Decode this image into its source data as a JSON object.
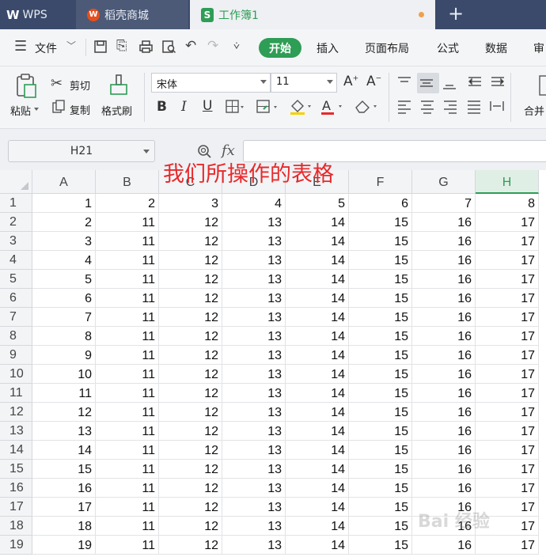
{
  "tabs": {
    "wps": "WPS",
    "store": "稻壳商城",
    "workbook": "工作簿1",
    "new_tab": "+"
  },
  "menu": {
    "file": "文件",
    "items": [
      "开始",
      "插入",
      "页面布局",
      "公式",
      "数据",
      "审"
    ]
  },
  "toolbar": {
    "paste": "粘贴",
    "cut": "剪切",
    "copy": "复制",
    "format_painter": "格式刷",
    "font_name": "宋体",
    "font_size": "11",
    "merge": "合并"
  },
  "formula_bar": {
    "cell_ref": "H21",
    "fx": "fx",
    "value": ""
  },
  "sheet": {
    "columns": [
      "A",
      "B",
      "C",
      "D",
      "E",
      "F",
      "G",
      "H"
    ],
    "active_column": "H",
    "rows": [
      {
        "num": "1",
        "cells": [
          "1",
          "2",
          "3",
          "4",
          "5",
          "6",
          "7",
          "8"
        ]
      },
      {
        "num": "2",
        "cells": [
          "2",
          "11",
          "12",
          "13",
          "14",
          "15",
          "16",
          "17"
        ]
      },
      {
        "num": "3",
        "cells": [
          "3",
          "11",
          "12",
          "13",
          "14",
          "15",
          "16",
          "17"
        ]
      },
      {
        "num": "4",
        "cells": [
          "4",
          "11",
          "12",
          "13",
          "14",
          "15",
          "16",
          "17"
        ]
      },
      {
        "num": "5",
        "cells": [
          "5",
          "11",
          "12",
          "13",
          "14",
          "15",
          "16",
          "17"
        ]
      },
      {
        "num": "6",
        "cells": [
          "6",
          "11",
          "12",
          "13",
          "14",
          "15",
          "16",
          "17"
        ]
      },
      {
        "num": "7",
        "cells": [
          "7",
          "11",
          "12",
          "13",
          "14",
          "15",
          "16",
          "17"
        ]
      },
      {
        "num": "8",
        "cells": [
          "8",
          "11",
          "12",
          "13",
          "14",
          "15",
          "16",
          "17"
        ]
      },
      {
        "num": "9",
        "cells": [
          "9",
          "11",
          "12",
          "13",
          "14",
          "15",
          "16",
          "17"
        ]
      },
      {
        "num": "10",
        "cells": [
          "10",
          "11",
          "12",
          "13",
          "14",
          "15",
          "16",
          "17"
        ]
      },
      {
        "num": "11",
        "cells": [
          "11",
          "11",
          "12",
          "13",
          "14",
          "15",
          "16",
          "17"
        ]
      },
      {
        "num": "12",
        "cells": [
          "12",
          "11",
          "12",
          "13",
          "14",
          "15",
          "16",
          "17"
        ]
      },
      {
        "num": "13",
        "cells": [
          "13",
          "11",
          "12",
          "13",
          "14",
          "15",
          "16",
          "17"
        ]
      },
      {
        "num": "14",
        "cells": [
          "14",
          "11",
          "12",
          "13",
          "14",
          "15",
          "16",
          "17"
        ]
      },
      {
        "num": "15",
        "cells": [
          "15",
          "11",
          "12",
          "13",
          "14",
          "15",
          "16",
          "17"
        ]
      },
      {
        "num": "16",
        "cells": [
          "16",
          "11",
          "12",
          "13",
          "14",
          "15",
          "16",
          "17"
        ]
      },
      {
        "num": "17",
        "cells": [
          "17",
          "11",
          "12",
          "13",
          "14",
          "15",
          "16",
          "17"
        ]
      },
      {
        "num": "18",
        "cells": [
          "18",
          "11",
          "12",
          "13",
          "14",
          "15",
          "16",
          "17"
        ]
      },
      {
        "num": "19",
        "cells": [
          "19",
          "11",
          "12",
          "13",
          "14",
          "15",
          "16",
          "17"
        ]
      }
    ]
  },
  "annotation": "我们所操作的表格",
  "watermark": "Bai 经验",
  "colors": {
    "accent": "#2e9d55",
    "annotation": "#e8292b",
    "titlebar": "#3b4a6b"
  },
  "icons": [
    "wps-logo-icon",
    "store-icon",
    "sheet-icon",
    "hamburger-icon",
    "save-icon",
    "export-icon",
    "print-icon",
    "print-preview-icon",
    "undo-icon",
    "redo-icon",
    "more-icon",
    "paste-icon",
    "cut-icon",
    "copy-icon",
    "format-painter-icon",
    "increase-font-icon",
    "decrease-font-icon",
    "bold-icon",
    "italic-icon",
    "underline-icon",
    "border-icon",
    "cell-fill-icon",
    "fill-color-icon",
    "font-color-icon",
    "clear-icon",
    "align-icons",
    "search-icon"
  ]
}
